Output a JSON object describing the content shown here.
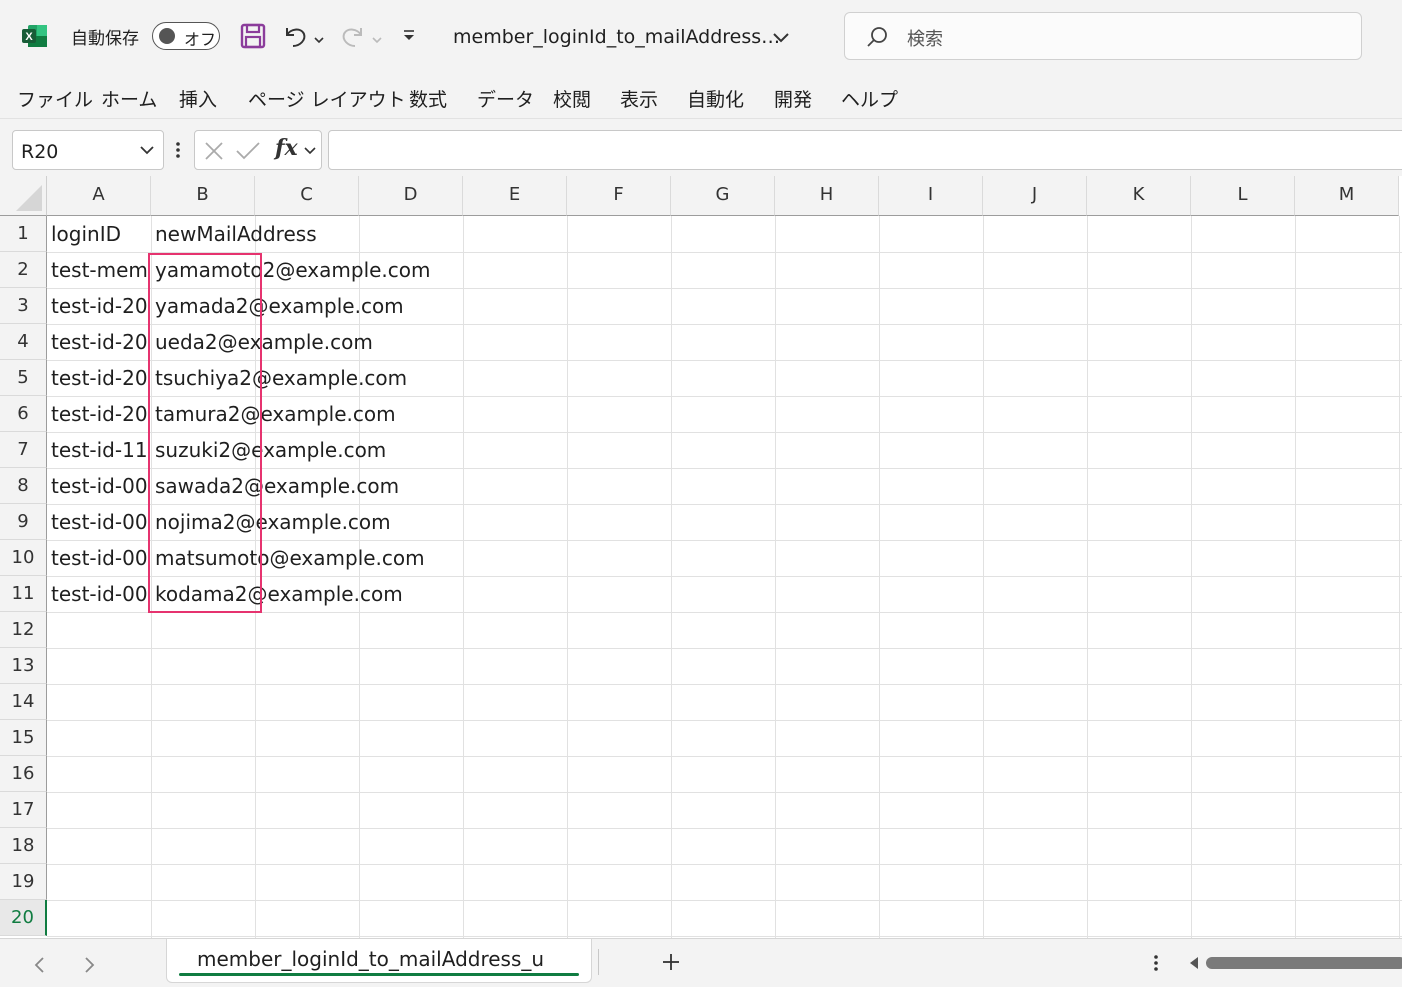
{
  "titlebar": {
    "autosave_label": "自動保存",
    "autosave_state": "オフ",
    "document_title": "member_loginId_to_mailAddress…",
    "search_placeholder": "検索"
  },
  "ribbon_tabs": [
    "ファイル",
    "ホーム",
    "挿入",
    "ページ レイアウト",
    "数式",
    "データ",
    "校閲",
    "表示",
    "自動化",
    "開発",
    "ヘルプ"
  ],
  "formula_bar": {
    "name_box": "R20",
    "fx_label": "fx",
    "formula": ""
  },
  "columns": [
    "A",
    "B",
    "C",
    "D",
    "E",
    "F",
    "G",
    "H",
    "I",
    "J",
    "K",
    "L",
    "M"
  ],
  "rows": [
    "1",
    "2",
    "3",
    "4",
    "5",
    "6",
    "7",
    "8",
    "9",
    "10",
    "11",
    "12",
    "13",
    "14",
    "15",
    "16",
    "17",
    "18",
    "19",
    "20"
  ],
  "active_row": "20",
  "cells": {
    "A": [
      "loginID",
      "test-mem",
      "test-id-20",
      "test-id-20",
      "test-id-20",
      "test-id-20",
      "test-id-11",
      "test-id-00",
      "test-id-00",
      "test-id-00",
      "test-id-00"
    ],
    "B": [
      "newMailAddress",
      "yamamoto2@example.com",
      "yamada2@example.com",
      "ueda2@example.com",
      "tsuchiya2@example.com",
      "tamura2@example.com",
      "suzuki2@example.com",
      "sawada2@example.com",
      "nojima2@example.com",
      "matsumoto@example.com",
      "kodama2@example.com"
    ]
  },
  "highlight_color": "#e6336f",
  "accent_color": "#107c41",
  "sheet_tab": "member_loginId_to_mailAddress_u",
  "icons": [
    "excel-logo-icon",
    "save-icon",
    "undo-icon",
    "redo-icon",
    "customize-qat-icon",
    "search-icon",
    "chevron-down-icon",
    "cancel-icon",
    "enter-icon",
    "more-options-icon",
    "prev-sheet-icon",
    "next-sheet-icon",
    "add-sheet-icon",
    "scroll-left-icon"
  ]
}
